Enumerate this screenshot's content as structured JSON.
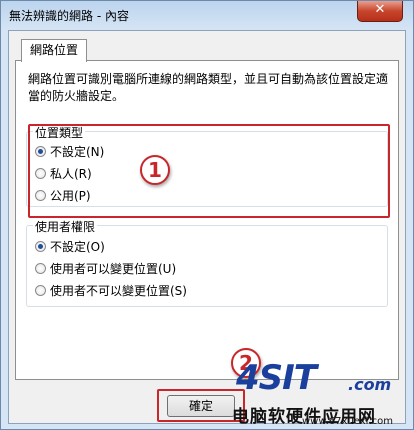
{
  "window": {
    "title": "無法辨識的網路 - 內容",
    "close_label": "✕"
  },
  "tab": {
    "label": "網路位置"
  },
  "description": "網路位置可識別電腦所連線的網路類型，並且可自動為該位置設定適當的防火牆設定。",
  "location_type": {
    "title": "位置類型",
    "options": [
      {
        "label": "不設定(N)",
        "selected": true
      },
      {
        "label": "私人(R)",
        "selected": false
      },
      {
        "label": "公用(P)",
        "selected": false
      }
    ]
  },
  "user_permissions": {
    "title": "使用者權限",
    "options": [
      {
        "label": "不設定(O)",
        "selected": true
      },
      {
        "label": "使用者可以變更位置(U)",
        "selected": false
      },
      {
        "label": "使用者不可以變更位置(S)",
        "selected": false
      }
    ]
  },
  "buttons": {
    "ok_label": "確定"
  },
  "annotations": {
    "callout_1": "1",
    "callout_2": "2"
  },
  "watermark": {
    "brand": "4SIT",
    "domain": ".com",
    "subtitle": "电脑软硬件应用网",
    "url": "www.67xuexi.com"
  },
  "colors": {
    "annotation_red": "#c7272b",
    "brand_blue": "#1a3f9c",
    "titlebar": "#bcd4ee"
  }
}
